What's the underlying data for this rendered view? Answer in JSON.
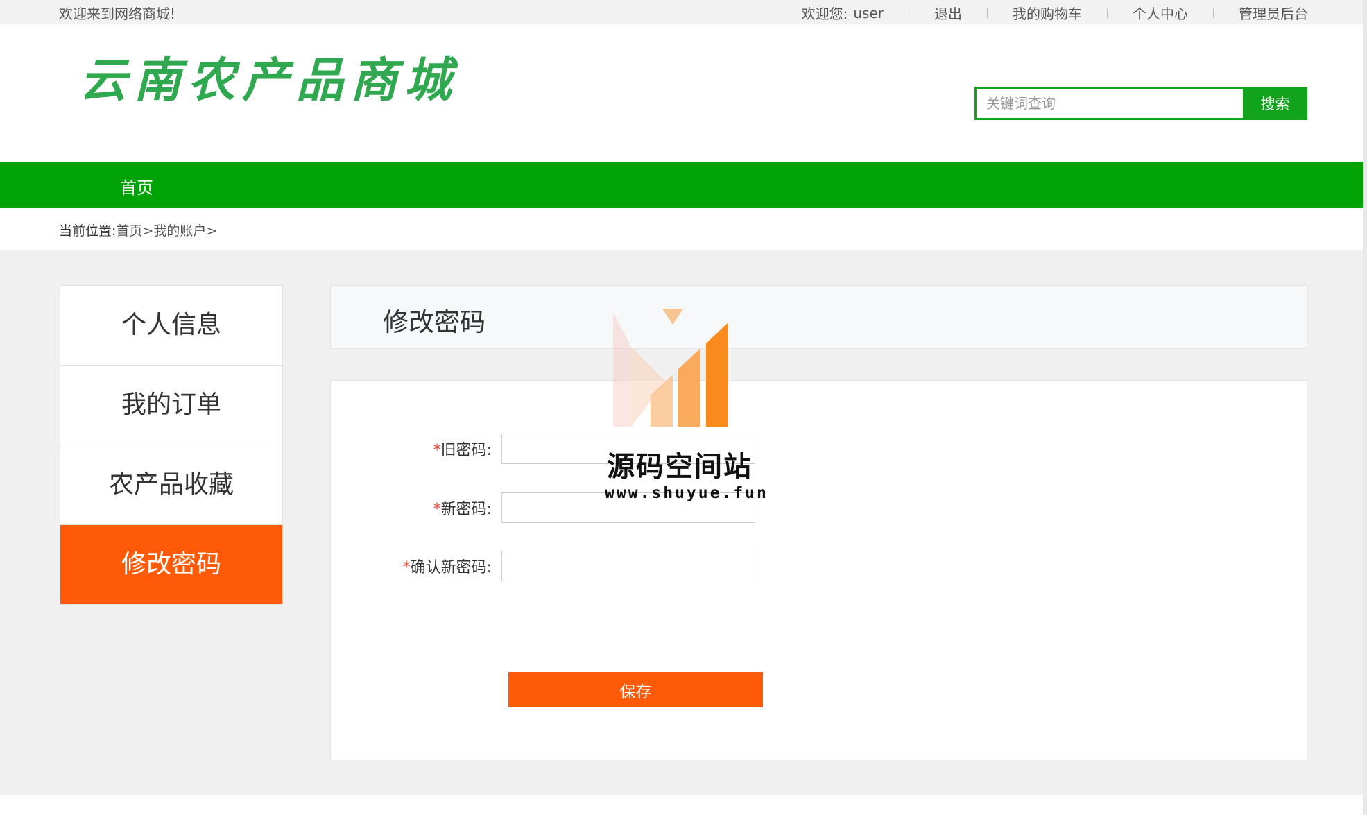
{
  "topbar": {
    "welcome": "欢迎来到网络商城!",
    "greeting": "欢迎您:",
    "username": "user",
    "logout": "退出",
    "cart": "我的购物车",
    "personal_center": "个人中心",
    "admin": "管理员后台"
  },
  "header": {
    "logo_text": "云南农产品商城",
    "search_placeholder": "关键词查询",
    "search_button": "搜索"
  },
  "nav": {
    "items": [
      {
        "label": "首页"
      }
    ]
  },
  "breadcrumb": {
    "prefix": "当前位置:",
    "items": [
      "首页",
      ">",
      "我的账户",
      ">"
    ]
  },
  "sidebar": {
    "items": [
      {
        "label": "个人信息",
        "active": false
      },
      {
        "label": "我的订单",
        "active": false
      },
      {
        "label": "农产品收藏",
        "active": false
      },
      {
        "label": "修改密码",
        "active": true
      }
    ]
  },
  "main": {
    "title": "修改密码",
    "fields": [
      {
        "required": "*",
        "label": "旧密码:",
        "value": ""
      },
      {
        "required": "*",
        "label": "新密码:",
        "value": ""
      },
      {
        "required": "*",
        "label": "确认新密码:",
        "value": ""
      }
    ],
    "save_button": "保存"
  },
  "watermark": {
    "title": "源码空间站",
    "url": "www.shuyue.fun"
  },
  "colors": {
    "brand_green": "#00a305",
    "accent_orange": "#ff5a08",
    "logo_green": "#2fa84f"
  }
}
